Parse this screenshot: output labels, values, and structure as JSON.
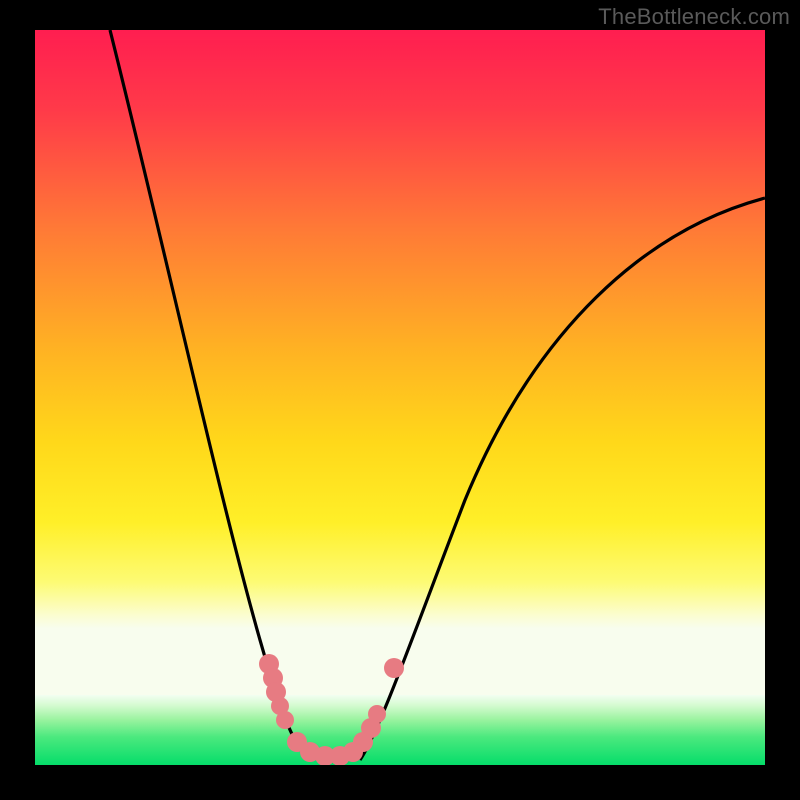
{
  "watermark": "TheBottleneck.com",
  "chart_data": {
    "type": "line",
    "title": "",
    "xlabel": "",
    "ylabel": "",
    "xlim": [
      0,
      100
    ],
    "ylim": [
      0,
      100
    ],
    "background": {
      "orientation": "vertical",
      "stops": [
        {
          "pos": 0.0,
          "color": "#ff1e50"
        },
        {
          "pos": 0.3,
          "color": "#ff7a36"
        },
        {
          "pos": 0.62,
          "color": "#ffd81a"
        },
        {
          "pos": 0.88,
          "color": "#fbfdd0"
        },
        {
          "pos": 0.91,
          "color": "#d4fbd0"
        },
        {
          "pos": 1.0,
          "color": "#05dd6a"
        }
      ]
    },
    "series": [
      {
        "name": "curve-left",
        "x": [
          10,
          15,
          20,
          25,
          30,
          34,
          37
        ],
        "y": [
          100,
          72,
          46,
          26,
          12,
          3,
          0
        ]
      },
      {
        "name": "curve-right",
        "x": [
          44,
          48,
          55,
          65,
          80,
          100
        ],
        "y": [
          0,
          6,
          22,
          45,
          64,
          77
        ]
      }
    ],
    "markers": [
      {
        "name": "left-cluster",
        "x": [
          31,
          31.5,
          32,
          32.5,
          33
        ],
        "y": [
          14,
          12,
          10,
          8,
          6
        ],
        "color": "#e77b82"
      },
      {
        "name": "valley",
        "x": [
          35,
          37,
          39,
          41,
          43,
          44,
          45,
          46
        ],
        "y": [
          3,
          1,
          0,
          0,
          1,
          3,
          5,
          7
        ],
        "color": "#e77b82"
      },
      {
        "name": "right-single",
        "x": [
          48
        ],
        "y": [
          13
        ],
        "color": "#e77b82"
      }
    ],
    "grid": false,
    "legend": false
  }
}
